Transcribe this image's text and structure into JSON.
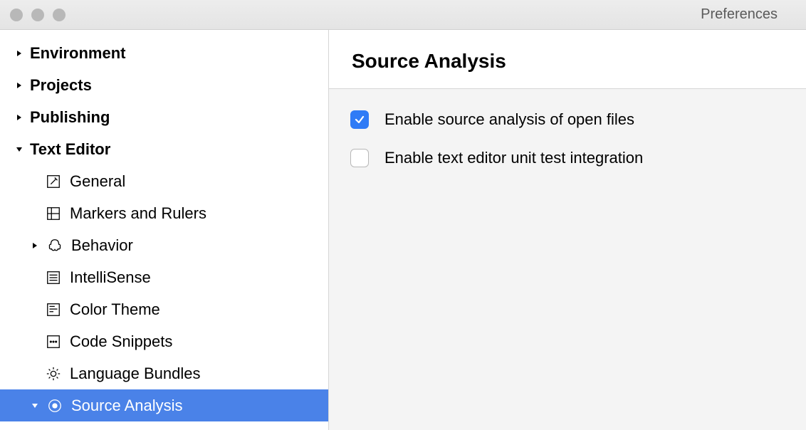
{
  "window": {
    "title": "Preferences"
  },
  "sidebar": {
    "items": [
      {
        "label": "Environment"
      },
      {
        "label": "Projects"
      },
      {
        "label": "Publishing"
      },
      {
        "label": "Text Editor"
      }
    ],
    "textEditor": {
      "children": [
        {
          "label": "General"
        },
        {
          "label": "Markers and Rulers"
        },
        {
          "label": "Behavior"
        },
        {
          "label": "IntelliSense"
        },
        {
          "label": "Color Theme"
        },
        {
          "label": "Code Snippets"
        },
        {
          "label": "Language Bundles"
        },
        {
          "label": "Source Analysis"
        }
      ]
    }
  },
  "main": {
    "title": "Source Analysis",
    "options": [
      {
        "label": "Enable source analysis of open files",
        "checked": true
      },
      {
        "label": "Enable text editor unit test integration",
        "checked": false
      }
    ]
  }
}
